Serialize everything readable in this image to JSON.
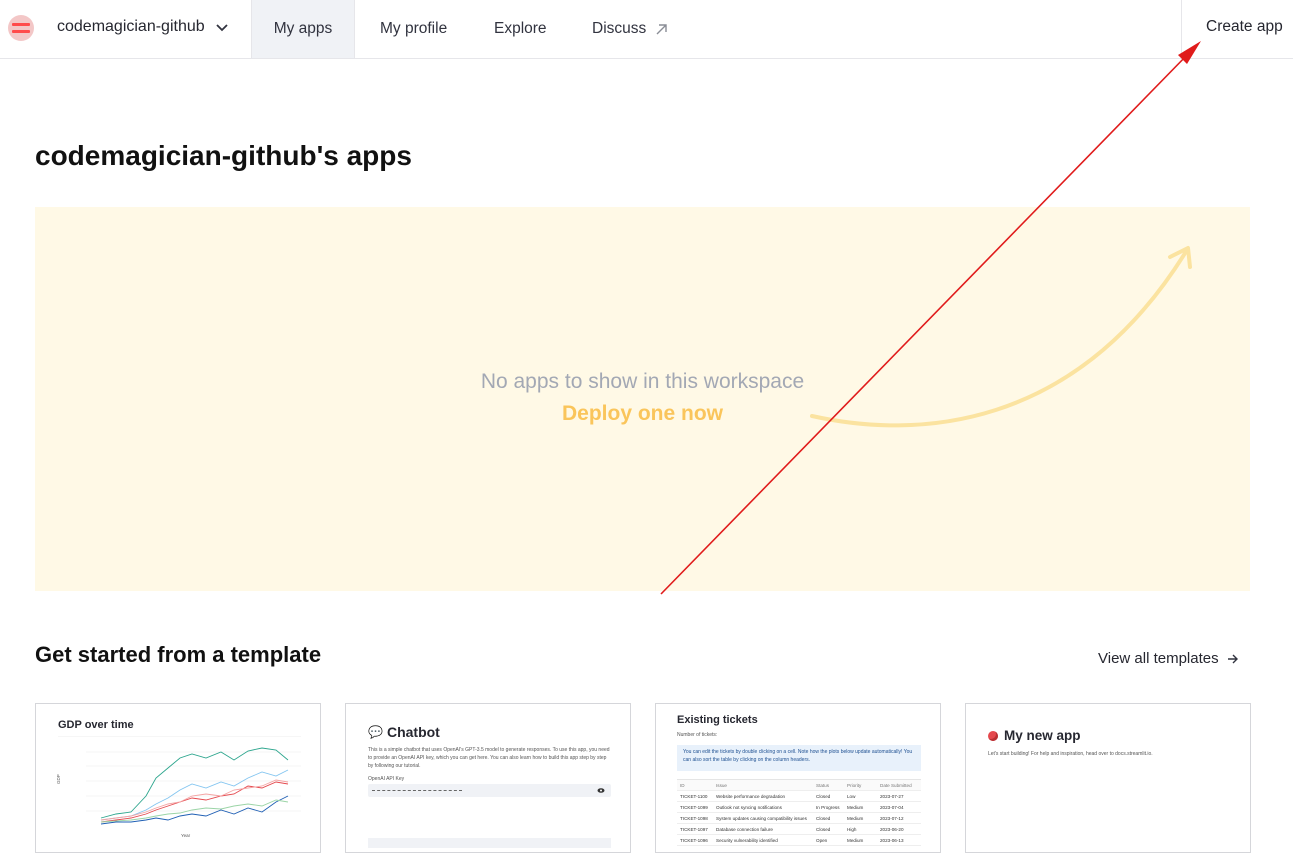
{
  "nav": {
    "workspace": "codemagician-github",
    "tabs": [
      "My apps",
      "My profile",
      "Explore",
      "Discuss"
    ],
    "create": "Create app"
  },
  "page": {
    "title": "codemagician-github's apps",
    "empty_message": "No apps to show in this workspace",
    "deploy": "Deploy one now"
  },
  "templates": {
    "heading": "Get started from a template",
    "view_all": "View all templates",
    "cards": [
      {
        "title": "GDP over time",
        "ylabel": "GDP",
        "xlabel": "Year"
      },
      {
        "title": "Chatbot",
        "desc": "This is a simple chatbot that uses OpenAI's GPT-3.5 model to generate responses. To use this app, you need to provide an OpenAI API key, which you can get here. You can also learn how to build this app step by step by following our tutorial.",
        "field_label": "OpenAI API Key"
      },
      {
        "title": "Existing tickets",
        "count_label": "Number of tickets:",
        "notice": "You can edit the tickets by double clicking on a cell. Note how the plots below update automatically! You can also sort the table by clicking on the column headers.",
        "columns": [
          "ID",
          "Issue",
          "Status",
          "Priority",
          "Date Submitted"
        ],
        "rows": [
          [
            "TICKET-1100",
            "Website performance degradation",
            "Closed",
            "Low",
            "2023-07-27"
          ],
          [
            "TICKET-1099",
            "Outlook not syncing notifications",
            "In Progress",
            "Medium",
            "2023-07-04"
          ],
          [
            "TICKET-1098",
            "System updates causing compatibility issues",
            "Closed",
            "Medium",
            "2023-07-12"
          ],
          [
            "TICKET-1097",
            "Database connection failure",
            "Closed",
            "High",
            "2023-06-20"
          ],
          [
            "TICKET-1096",
            "Security vulnerability identified",
            "Open",
            "Medium",
            "2023-06-13"
          ]
        ]
      },
      {
        "title": "My new app",
        "desc": "Let's start building! For help and inspiration, head over to docs.streamlit.io."
      }
    ]
  },
  "colors": {
    "accent": "#ff4b4b",
    "empty_bg": "#fff9e6",
    "deploy": "#fac55b",
    "annotation": "#e01b1b"
  }
}
